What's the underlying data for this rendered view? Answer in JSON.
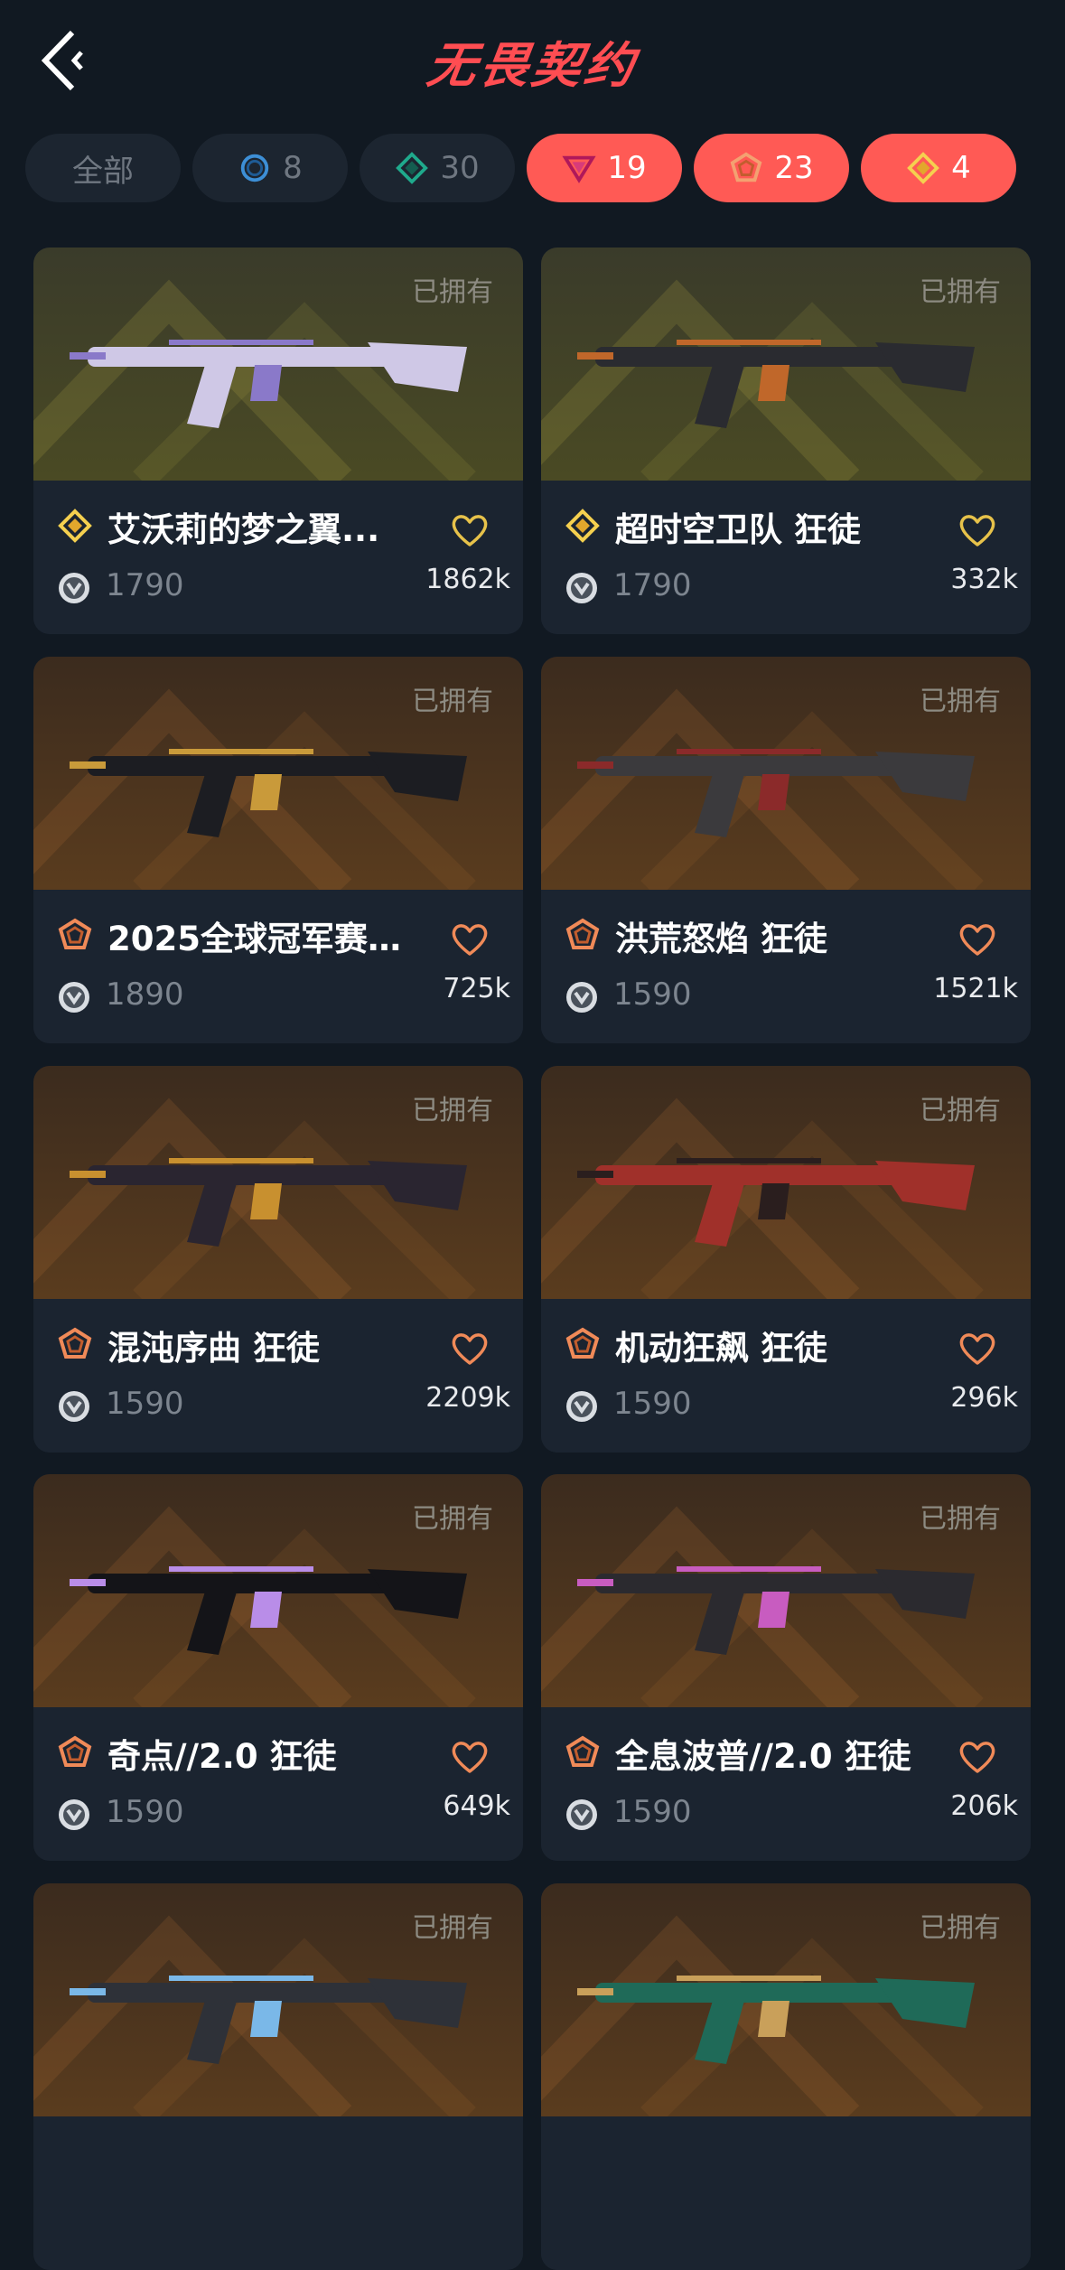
{
  "header": {
    "title": "无畏契约"
  },
  "filters": [
    {
      "label": "全部",
      "icon": "",
      "style": "dark"
    },
    {
      "label": "8",
      "icon": "select-tier-icon",
      "style": "dark"
    },
    {
      "label": "30",
      "icon": "deluxe-tier-icon",
      "style": "dark"
    },
    {
      "label": "19",
      "icon": "premium-tier-icon",
      "style": "red"
    },
    {
      "label": "23",
      "icon": "exclusive-tier-icon",
      "style": "red"
    },
    {
      "label": "4",
      "icon": "ultra-tier-icon",
      "style": "red"
    }
  ],
  "colors": {
    "accent": "#ff5a55",
    "background": "#111922",
    "card": "#1b2430",
    "ultra": "#e7c24a",
    "exclusive": "#f08a58"
  },
  "owned_label": "已拥有",
  "cards": [
    {
      "name": "艾沃莉的梦之翼...",
      "price": "1790",
      "likes": "1862k",
      "tier": "ultra"
    },
    {
      "name": "超时空卫队 狂徒",
      "price": "1790",
      "likes": "332k",
      "tier": "ultra"
    },
    {
      "name": "2025全球冠军赛...",
      "price": "1890",
      "likes": "725k",
      "tier": "exclusive"
    },
    {
      "name": "洪荒怒焰 狂徒",
      "price": "1590",
      "likes": "1521k",
      "tier": "exclusive"
    },
    {
      "name": "混沌序曲 狂徒",
      "price": "1590",
      "likes": "2209k",
      "tier": "exclusive"
    },
    {
      "name": "机动狂飙 狂徒",
      "price": "1590",
      "likes": "296k",
      "tier": "exclusive"
    },
    {
      "name": "奇点//2.0 狂徒",
      "price": "1590",
      "likes": "649k",
      "tier": "exclusive"
    },
    {
      "name": "全息波普//2.0 狂徒",
      "price": "1590",
      "likes": "206k",
      "tier": "exclusive"
    },
    {
      "name": "",
      "price": "",
      "likes": "",
      "tier": "exclusive"
    },
    {
      "name": "",
      "price": "",
      "likes": "",
      "tier": "exclusive"
    }
  ]
}
